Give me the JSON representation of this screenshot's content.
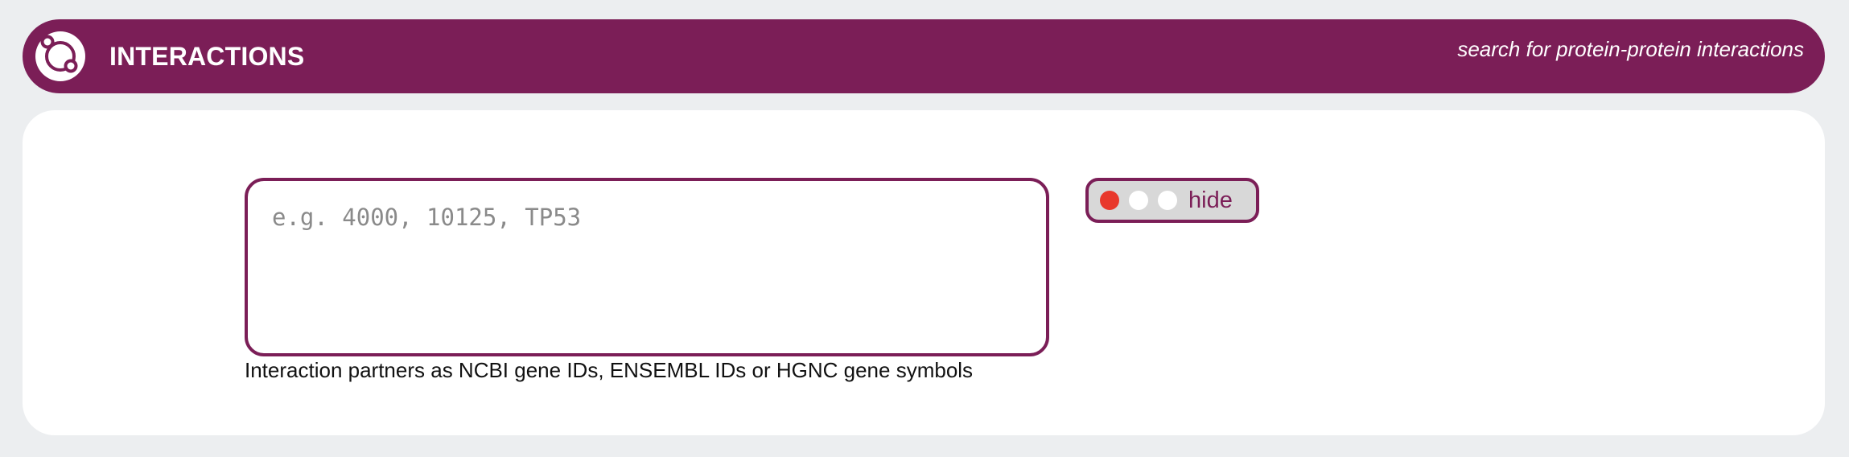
{
  "header": {
    "logo_icon": "interactions-network-icon",
    "title": "INTERACTIONS",
    "tagline": "search for protein-protein interactions",
    "color": "#7b1e57"
  },
  "search": {
    "value": "",
    "placeholder": "e.g. 4000, 10125, TP53",
    "hint": "Interaction partners as NCBI gene IDs, ENSEMBL IDs or HGNC gene symbols"
  },
  "visibility_toggle": {
    "label": "hide",
    "selected_index": 0,
    "active_color": "#e8382b",
    "options_count": 3
  }
}
